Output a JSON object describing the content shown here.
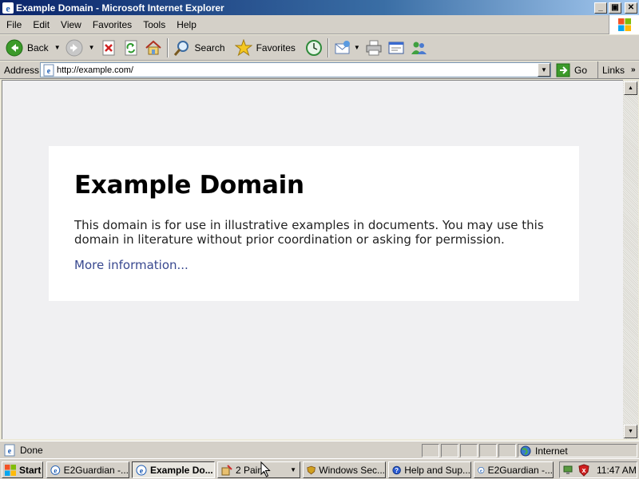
{
  "window": {
    "title": "Example Domain - Microsoft Internet Explorer",
    "minimize": "_",
    "maximize": "▣",
    "close": "✕"
  },
  "menu": [
    "File",
    "Edit",
    "View",
    "Favorites",
    "Tools",
    "Help"
  ],
  "toolbar": {
    "back_label": "Back",
    "search_label": "Search",
    "favorites_label": "Favorites"
  },
  "address": {
    "label": "Address",
    "url": "http://example.com/",
    "go_label": "Go",
    "links_label": "Links",
    "links_chevron": "»"
  },
  "page": {
    "heading": "Example Domain",
    "body": "This domain is for use in illustrative examples in documents. You may use this domain in literature without prior coordination or asking for permission.",
    "link": "More information..."
  },
  "status": {
    "text": "Done",
    "zone": "Internet"
  },
  "taskbar": {
    "start_label": "Start",
    "tasks": [
      {
        "label": "E2Guardian -...",
        "icon": "ie-icon"
      },
      {
        "label": "Example Do...",
        "icon": "ie-icon",
        "active": true
      },
      {
        "label": "2 Paint",
        "icon": "paint-icon"
      },
      {
        "label": "Windows Sec...",
        "icon": "security-shield-icon"
      },
      {
        "label": "Help and Sup...",
        "icon": "help-icon"
      },
      {
        "label": "E2Guardian -...",
        "icon": "ie-icon"
      }
    ],
    "clock": "11:47 AM"
  },
  "colors": {
    "titlebar_start": "#0a246a",
    "link": "#38488f",
    "page_bg": "#f0f0f2"
  }
}
